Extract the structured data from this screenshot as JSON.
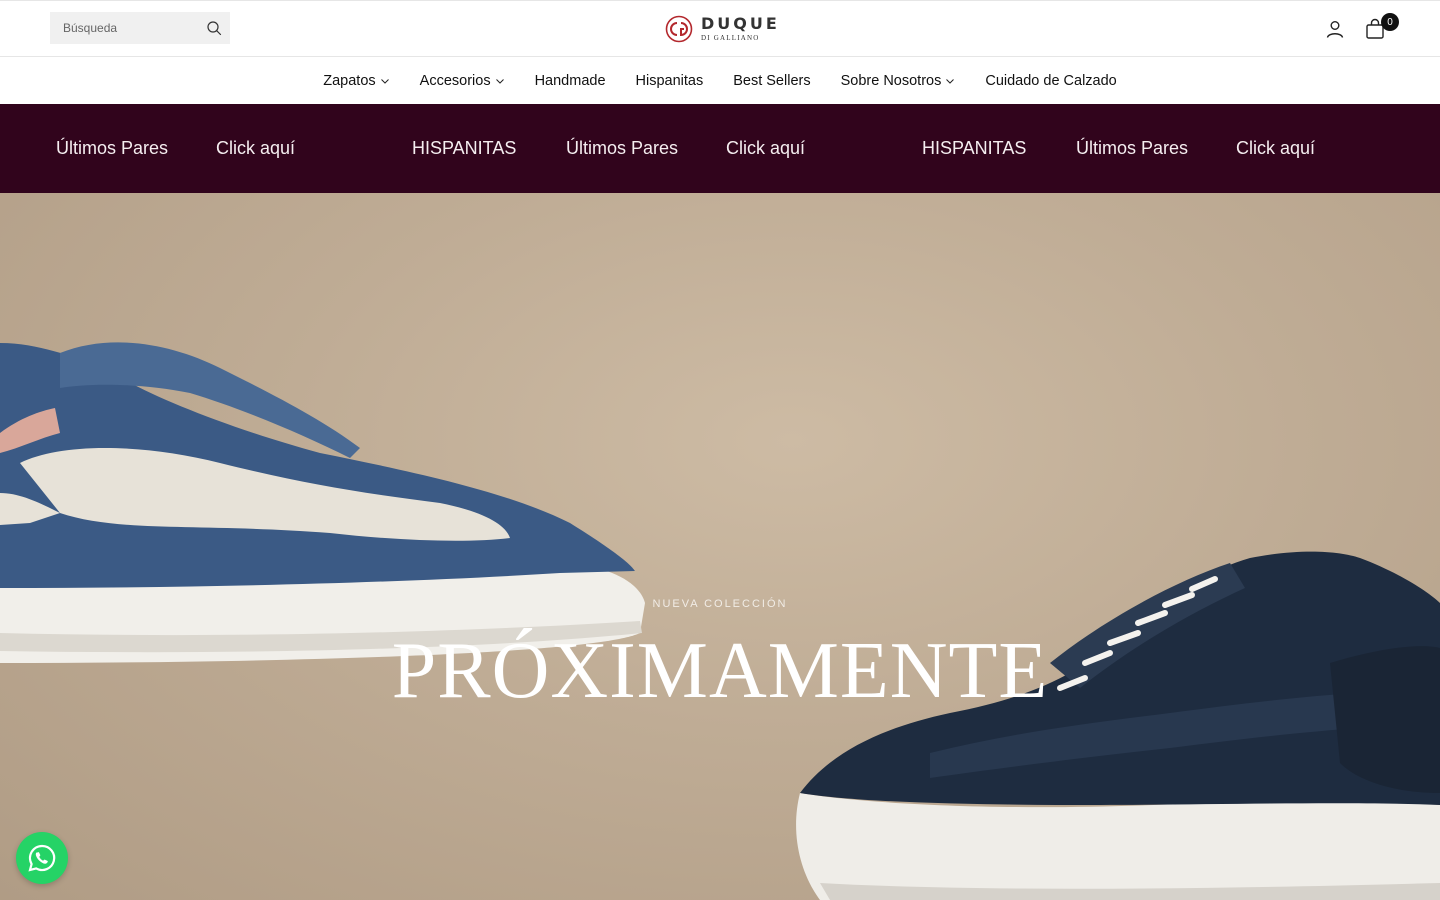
{
  "header": {
    "search": {
      "placeholder": "Búsqueda",
      "value": ""
    },
    "logo": {
      "brand": "DUQUE",
      "sub": "DI GALLIANO"
    },
    "cart_count": "0",
    "icons": {
      "search": "search-icon",
      "account": "user-icon",
      "cart": "bag-icon"
    }
  },
  "nav": {
    "items": [
      {
        "label": "Zapatos",
        "has_dropdown": true
      },
      {
        "label": "Accesorios",
        "has_dropdown": true
      },
      {
        "label": "Handmade",
        "has_dropdown": false
      },
      {
        "label": "Hispanitas",
        "has_dropdown": false
      },
      {
        "label": "Best Sellers",
        "has_dropdown": false
      },
      {
        "label": "Sobre Nosotros",
        "has_dropdown": true
      },
      {
        "label": "Cuidado de Calzado",
        "has_dropdown": false
      }
    ]
  },
  "marquee": {
    "items": [
      "Últimos Pares",
      "Click aquí",
      "HISPANITAS",
      "Últimos Pares",
      "Click aquí",
      "HISPANITAS",
      "Últimos Pares",
      "Click aquí"
    ]
  },
  "hero": {
    "eyebrow": "NUEVA COLECCIÓN",
    "title": "PRÓXIMAMENTE"
  },
  "colors": {
    "marquee_bg": "#31041c",
    "logo_accent": "#b3282d",
    "whatsapp": "#25d366"
  }
}
